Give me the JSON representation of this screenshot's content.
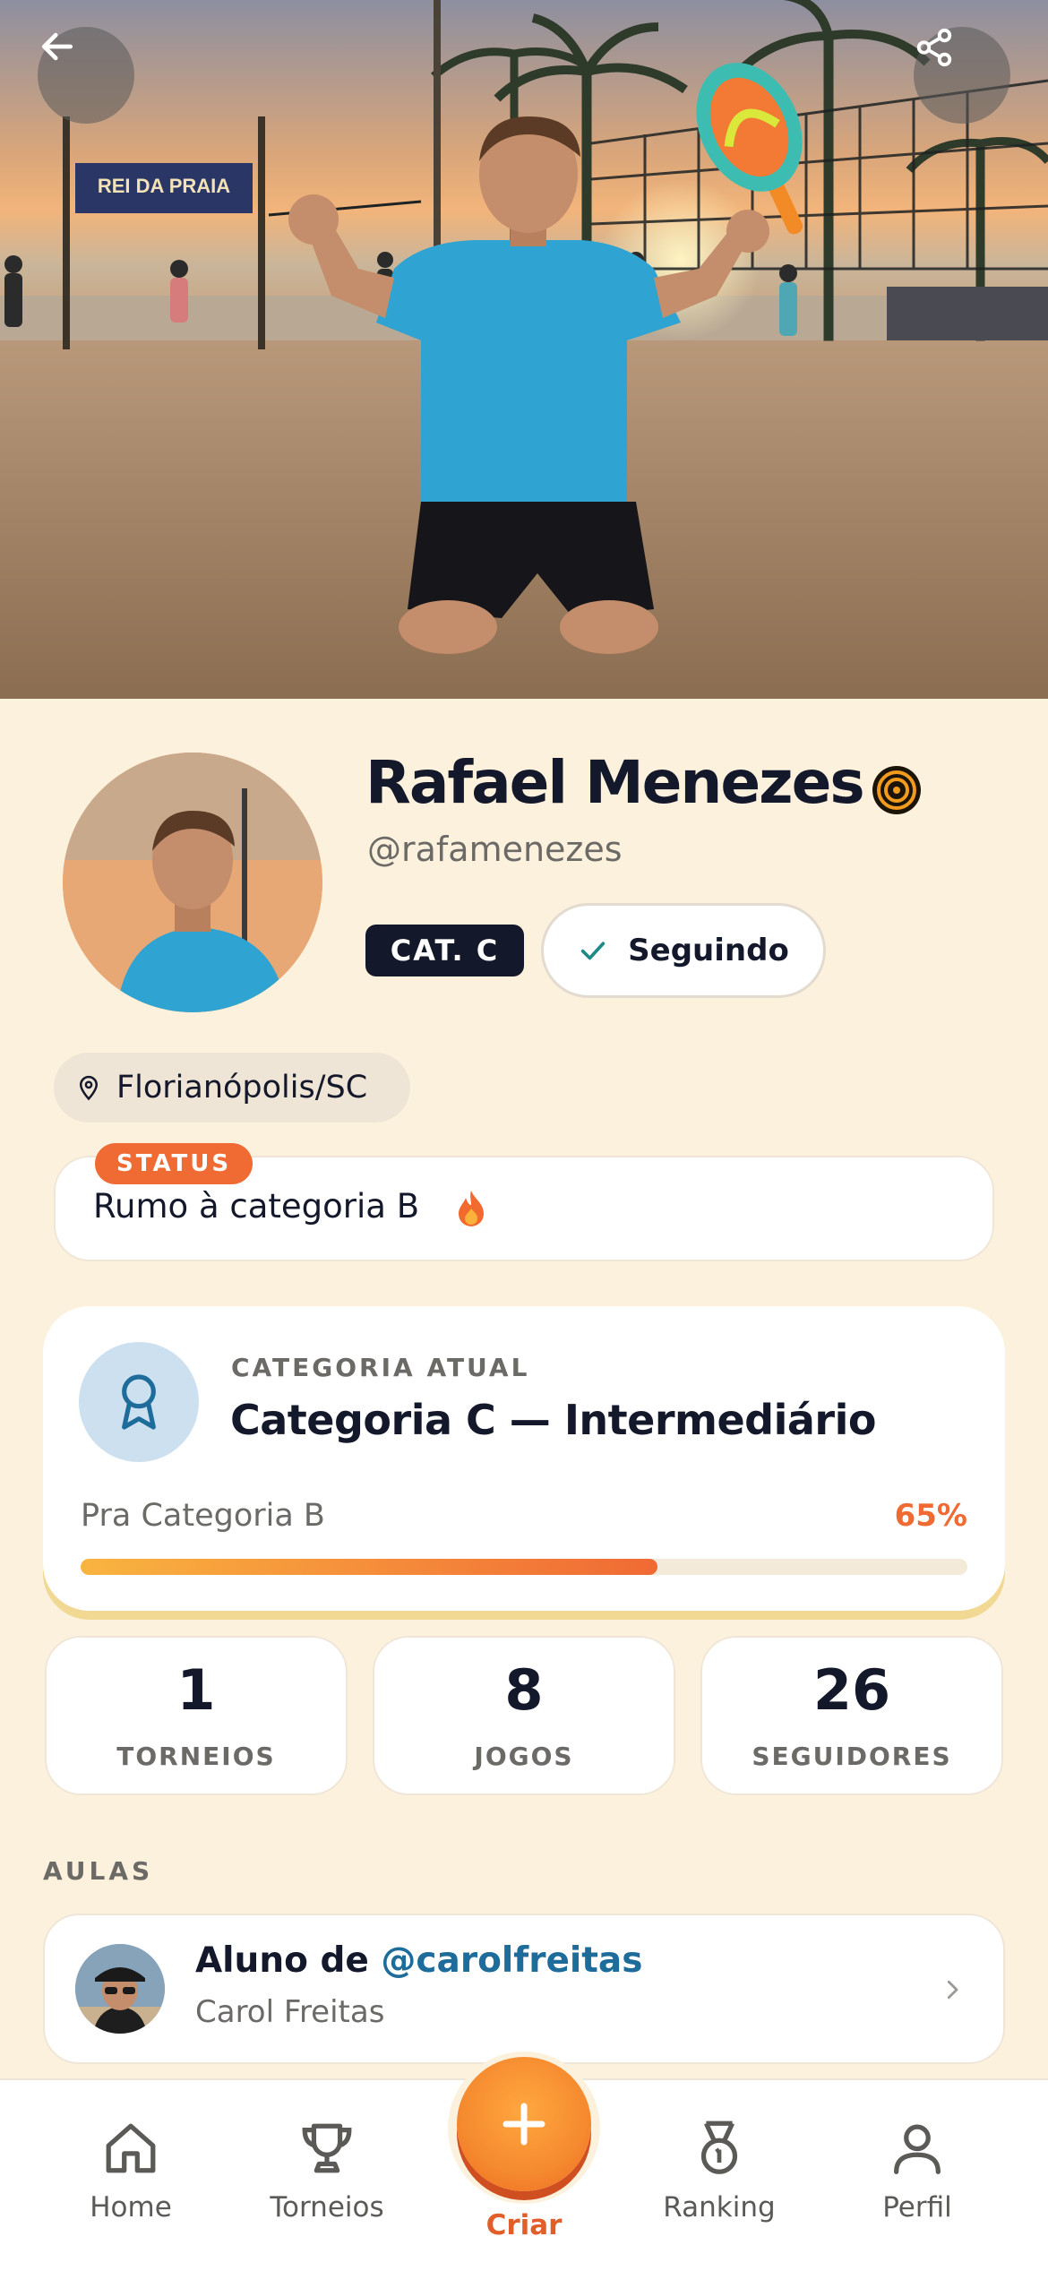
{
  "hero": {
    "banner_text": "REI DA PRAIA",
    "back_icon": "arrow-left-icon",
    "share_icon": "share-icon"
  },
  "profile": {
    "name": "Rafael Menezes",
    "handle": "@rafamenezes",
    "category_chip": "CAT. C",
    "follow_label": "Seguindo",
    "location": "Florianópolis/SC"
  },
  "status": {
    "tag": "STATUS",
    "text": "Rumo à categoria B"
  },
  "category": {
    "label": "CATEGORIA ATUAL",
    "title": "Categoria C — Intermediário",
    "progress_label": "Pra Categoria B",
    "progress_text": "65%",
    "progress_value": 0.65
  },
  "stats": [
    {
      "value": "1",
      "label": "TORNEIOS"
    },
    {
      "value": "8",
      "label": "JOGOS"
    },
    {
      "value": "26",
      "label": "SEGUIDORES"
    }
  ],
  "aulas": {
    "section_title": "AULAS",
    "prefix": "Aluno de",
    "teacher_handle": "@carolfreitas",
    "teacher_name": "Carol Freitas"
  },
  "nav": {
    "items": [
      {
        "label": "Home",
        "icon": "home-icon"
      },
      {
        "label": "Torneios",
        "icon": "trophy-icon"
      },
      {
        "label": "Criar",
        "icon": "plus-icon"
      },
      {
        "label": "Ranking",
        "icon": "medal-icon"
      },
      {
        "label": "Perfil",
        "icon": "user-icon"
      }
    ]
  },
  "colors": {
    "background": "#fcf1dd",
    "accent": "#f06a34",
    "navy": "#14182b",
    "link": "#1d6c9a"
  }
}
